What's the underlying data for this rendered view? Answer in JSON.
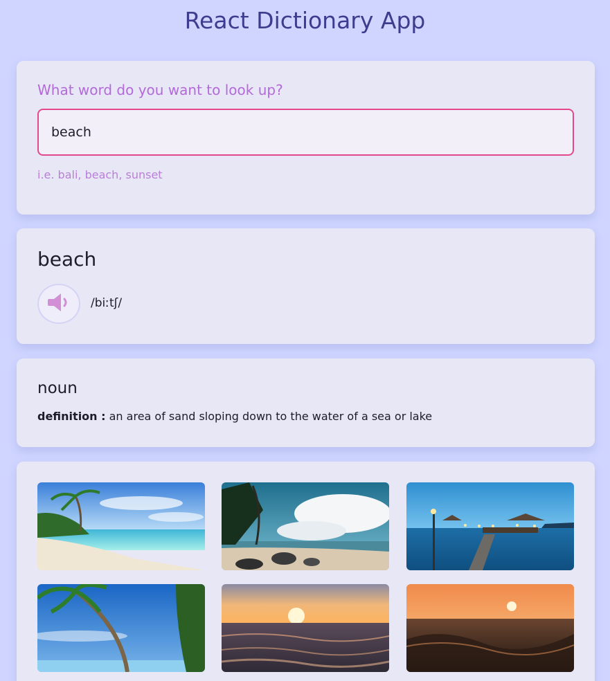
{
  "app": {
    "title": "React Dictionary App"
  },
  "search": {
    "question": "What word do you want to look up?",
    "value": "beach",
    "hint": "i.e. bali, beach, sunset"
  },
  "word": {
    "text": "beach",
    "phonetic": "/biːtʃ/",
    "audio_icon": "speaker-icon"
  },
  "meaning": {
    "part_of_speech": "noun",
    "definition_label": "definition :",
    "definition_text": "an area of sand sloping down to the water of a sea or lake"
  },
  "photos": [
    {
      "subject": "tropical beach with palm trees and turquoise water"
    },
    {
      "subject": "rocky beach with palm trees and clouds"
    },
    {
      "subject": "wooden pier with lanterns at dusk"
    },
    {
      "subject": "palm tree against blue sky"
    },
    {
      "subject": "sunset over ocean waves"
    },
    {
      "subject": "sunset over dark water close-up"
    }
  ],
  "colors": {
    "background": "#cfd5ff",
    "card": "#e8e7f6",
    "title": "#3f3c8f",
    "accent_purple": "#b36ad9",
    "input_border": "#e2498c"
  }
}
